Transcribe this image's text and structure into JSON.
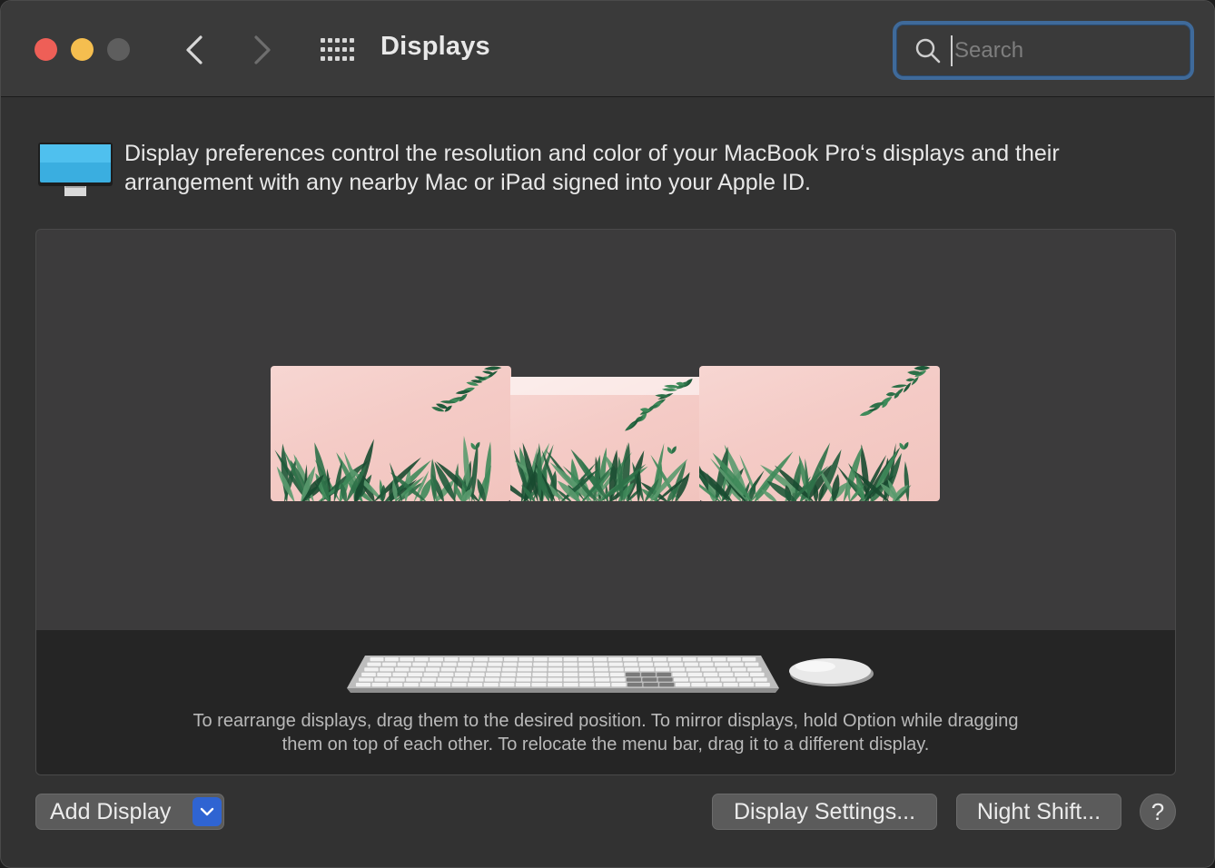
{
  "window": {
    "title": "Displays"
  },
  "search": {
    "placeholder": "Search",
    "value": ""
  },
  "description": {
    "text": "Display preferences control the resolution and color of your MacBook Pro‘s displays and their arrangement with any nearby Mac or iPad signed into your Apple ID."
  },
  "arrangement": {
    "hint_line1": "To rearrange displays, drag them to the desired position. To mirror displays, hold Option while dragging",
    "hint_line2": "them on top of each other. To relocate the menu bar, drag it to a different display.",
    "display_count": 3
  },
  "buttons": {
    "add_display": "Add Display",
    "display_settings": "Display Settings...",
    "night_shift": "Night Shift...",
    "help": "?"
  },
  "icons": {
    "close": "close-icon",
    "minimize": "minimize-icon",
    "zoom": "zoom-icon",
    "back": "chevron-left-icon",
    "forward": "chevron-right-icon",
    "grid": "grid-icon",
    "search": "search-icon",
    "display": "display-icon",
    "keyboard": "keyboard-icon",
    "mouse": "mouse-icon",
    "dropdown": "chevron-down-icon"
  },
  "colors": {
    "accent": "#2f64d2",
    "focus_ring": "#3f6a9a",
    "close": "#ee5f57",
    "minimize": "#f5be4f",
    "window_bg": "#323232"
  }
}
